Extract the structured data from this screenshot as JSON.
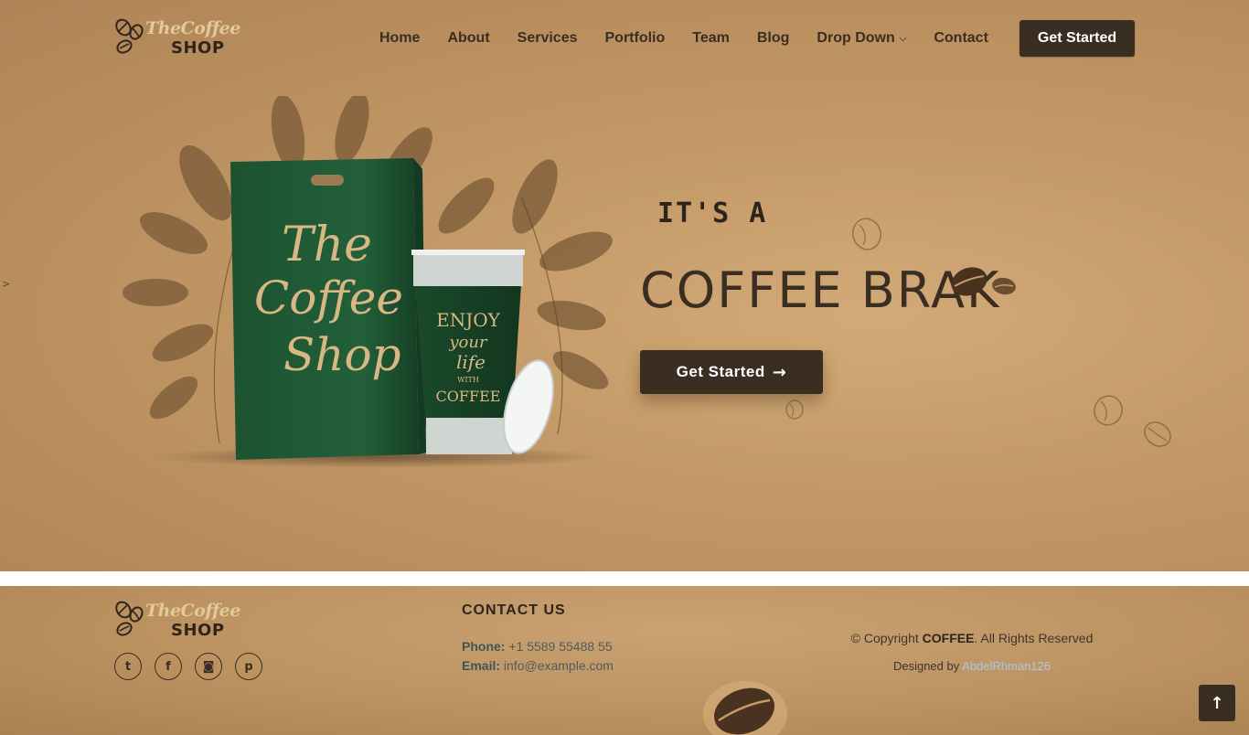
{
  "brand": {
    "logo_top": "TheCoffee",
    "logo_bottom": "SHOP"
  },
  "nav": {
    "items": [
      {
        "label": "Home"
      },
      {
        "label": "About"
      },
      {
        "label": "Services"
      },
      {
        "label": "Portfolio"
      },
      {
        "label": "Team"
      },
      {
        "label": "Blog"
      },
      {
        "label": "Drop Down",
        "has_dropdown": true,
        "icon": "chevron-down-icon"
      },
      {
        "label": "Contact"
      }
    ],
    "cta_label": "Get Started"
  },
  "hero": {
    "side_marker": ">",
    "line1": "IT'S A",
    "line2": "COFFEE BRAK",
    "cta_label": "Get Started",
    "cta_icon": "arrow-right-icon",
    "illustration": {
      "bag_text": [
        "The",
        "Coffee",
        "Shop"
      ],
      "cup_text": [
        "ENJOY",
        "your",
        "life",
        "WITH",
        "COFFEE"
      ]
    }
  },
  "footer": {
    "logo_top": "TheCoffee",
    "logo_bottom": "SHOP",
    "socials": [
      {
        "name": "twitter-icon",
        "glyph": "t"
      },
      {
        "name": "facebook-icon",
        "glyph": "f"
      },
      {
        "name": "instagram-icon",
        "glyph": "◙"
      },
      {
        "name": "pinterest-icon",
        "glyph": "p"
      }
    ],
    "contact": {
      "title": "CONTACT US",
      "phone_label": "Phone:",
      "phone": "+1 5589 55488 55",
      "email_label": "Email:",
      "email": "info@example.com"
    },
    "copyright": {
      "prefix": "© Copyright",
      "brand": "COFFEE",
      "suffix": ". All Rights Reserved"
    },
    "designed": {
      "prefix": "Designed by",
      "author": "AbdelRhman126"
    }
  },
  "scroll_top": {
    "icon": "arrow-up-icon",
    "glyph": "↑"
  },
  "colors": {
    "hero_bg": "#c49b68",
    "accent_dark": "#3a2d22",
    "bag_green": "#1f5633",
    "logo_light": "#e3c89c",
    "link_blue": "#a9c8e6"
  }
}
